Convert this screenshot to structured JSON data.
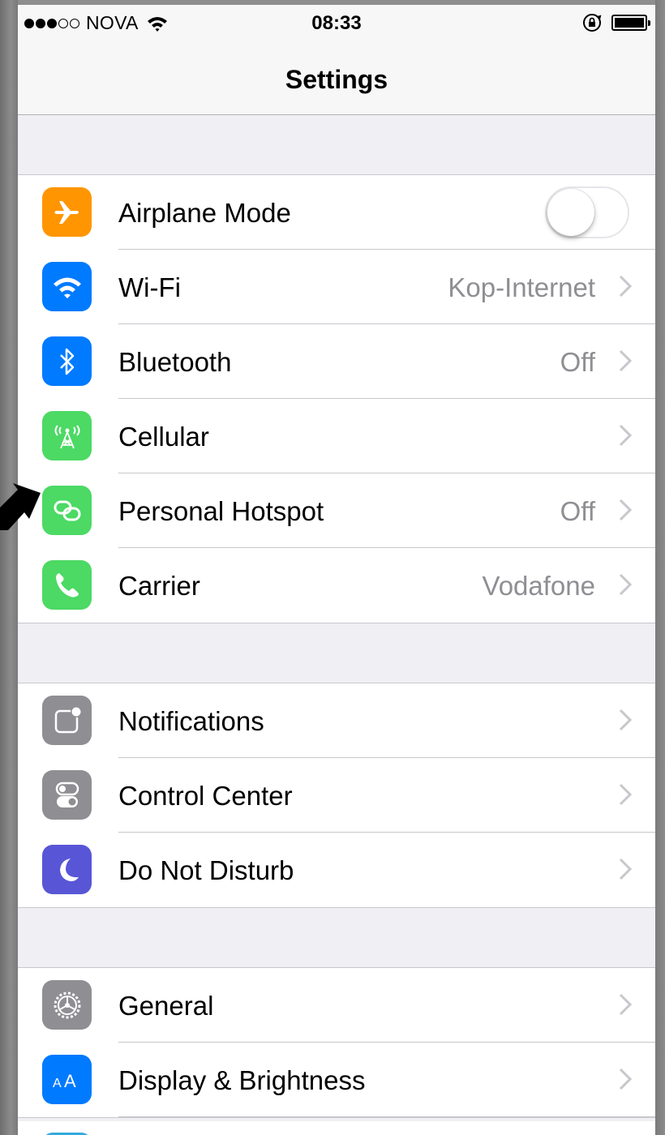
{
  "status_bar": {
    "carrier": "NOVA",
    "signal_bars_filled": 3,
    "signal_bars_total": 5,
    "time": "08:33"
  },
  "nav": {
    "title": "Settings"
  },
  "groups": [
    {
      "items": [
        {
          "label": "Airplane Mode",
          "icon": "airplane-icon",
          "icon_color": "#ff9500",
          "control": "toggle",
          "toggle_on": false
        },
        {
          "label": "Wi-Fi",
          "value": "Kop-Internet",
          "icon": "wifi-icon",
          "icon_color": "#007aff"
        },
        {
          "label": "Bluetooth",
          "value": "Off",
          "icon": "bluetooth-icon",
          "icon_color": "#007aff"
        },
        {
          "label": "Cellular",
          "value": "",
          "icon": "cellular-icon",
          "icon_color": "#4cd964"
        },
        {
          "label": "Personal Hotspot",
          "value": "Off",
          "icon": "hotspot-icon",
          "icon_color": "#4cd964"
        },
        {
          "label": "Carrier",
          "value": "Vodafone",
          "icon": "phone-icon",
          "icon_color": "#4cd964"
        }
      ]
    },
    {
      "items": [
        {
          "label": "Notifications",
          "icon": "notifications-icon",
          "icon_color": "#8e8e93"
        },
        {
          "label": "Control Center",
          "icon": "control-center-icon",
          "icon_color": "#8e8e93"
        },
        {
          "label": "Do Not Disturb",
          "icon": "moon-icon",
          "icon_color": "#5856d6"
        }
      ]
    },
    {
      "items": [
        {
          "label": "General",
          "icon": "gear-icon",
          "icon_color": "#8e8e93"
        },
        {
          "label": "Display & Brightness",
          "icon": "display-icon",
          "icon_color": "#007aff"
        }
      ]
    }
  ],
  "annotation": {
    "icon": "pointer-arrow-icon",
    "color": "#000000",
    "points_to": "Personal Hotspot"
  }
}
